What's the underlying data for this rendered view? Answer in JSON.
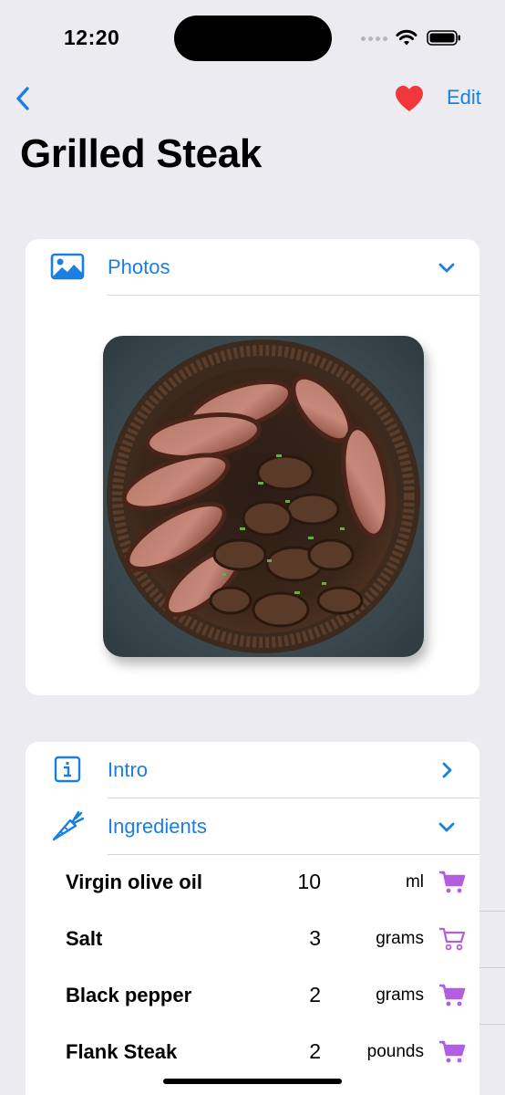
{
  "status_bar": {
    "time": "12:20"
  },
  "nav": {
    "back_icon": "chevron-left-icon",
    "favorite_icon": "heart-icon",
    "edit_label": "Edit"
  },
  "title": "Grilled Steak",
  "photos_section": {
    "label": "Photos",
    "icon": "photo-icon",
    "expanded": true
  },
  "intro_section": {
    "label": "Intro",
    "icon": "info-icon",
    "expanded": false
  },
  "ingredients_section": {
    "label": "Ingredients",
    "icon": "carrot-icon",
    "expanded": true,
    "items": [
      {
        "name": "Virgin olive oil",
        "quantity": "10",
        "unit": "ml",
        "in_cart": true
      },
      {
        "name": "Salt",
        "quantity": "3",
        "unit": "grams",
        "in_cart": false
      },
      {
        "name": "Black pepper",
        "quantity": "2",
        "unit": "grams",
        "in_cart": true
      },
      {
        "name": "Flank Steak",
        "quantity": "2",
        "unit": "pounds",
        "in_cart": true
      }
    ]
  },
  "colors": {
    "accent": "#1a7fe0",
    "favorite": "#f0373a",
    "cart": "#b15fe0",
    "background": "#ececf0"
  }
}
